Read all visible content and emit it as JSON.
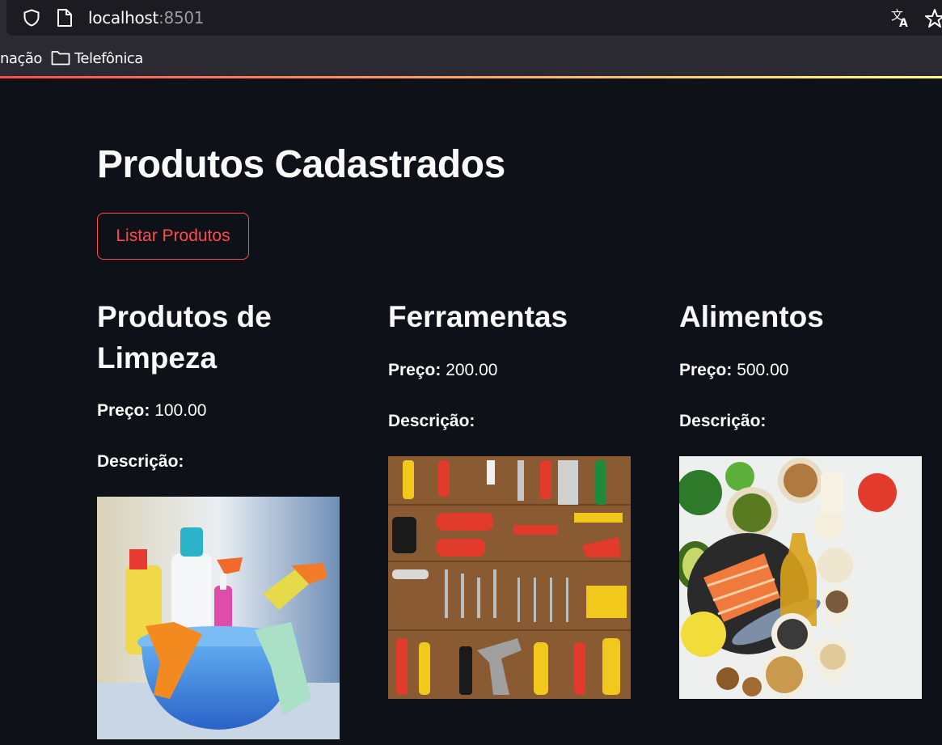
{
  "browser": {
    "url_host": "localhost",
    "url_port": ":8501",
    "bookmarks": [
      "nação",
      "Telefônica"
    ]
  },
  "page": {
    "title": "Produtos Cadastrados",
    "list_button": "Listar Produtos",
    "price_label": "Preço:",
    "description_label": "Descrição:"
  },
  "products": [
    {
      "name": "Produtos de Limpeza",
      "price": "100.00",
      "description": "",
      "image": "cleaning-supplies-bucket"
    },
    {
      "name": "Ferramentas",
      "price": "200.00",
      "description": "",
      "image": "tools-on-wood"
    },
    {
      "name": "Alimentos",
      "price": "500.00",
      "description": "",
      "image": "healthy-food-spread"
    }
  ],
  "colors": {
    "background": "#0e1117",
    "accent": "#ff4b4b",
    "text": "#fafafa"
  }
}
